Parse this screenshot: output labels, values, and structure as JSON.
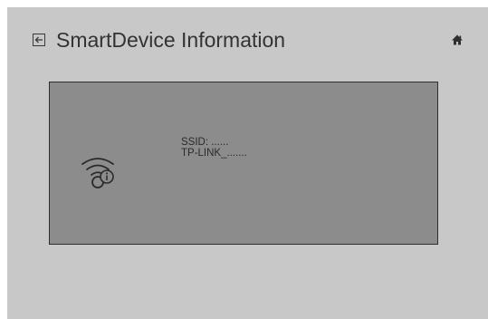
{
  "header": {
    "title": "SmartDevice Information",
    "back_icon": "back-arrow-icon",
    "home_icon": "home-icon"
  },
  "device_card": {
    "icon": "wifi-info-icon",
    "ssid_line": "SSID: ......",
    "network_line": "TP-LINK_......."
  },
  "colors": {
    "screen_background": "#c8c8c8",
    "card_background": "#8c8c8c",
    "card_border": "#2e2e2e",
    "text": "#333333"
  }
}
